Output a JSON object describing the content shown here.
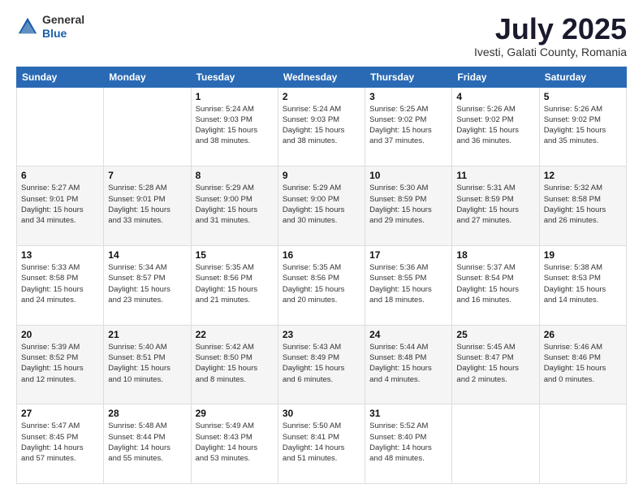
{
  "header": {
    "logo_general": "General",
    "logo_blue": "Blue",
    "month_title": "July 2025",
    "location": "Ivesti, Galati County, Romania"
  },
  "columns": [
    "Sunday",
    "Monday",
    "Tuesday",
    "Wednesday",
    "Thursday",
    "Friday",
    "Saturday"
  ],
  "weeks": [
    [
      {
        "day": "",
        "info": ""
      },
      {
        "day": "",
        "info": ""
      },
      {
        "day": "1",
        "info": "Sunrise: 5:24 AM\nSunset: 9:03 PM\nDaylight: 15 hours\nand 38 minutes."
      },
      {
        "day": "2",
        "info": "Sunrise: 5:24 AM\nSunset: 9:03 PM\nDaylight: 15 hours\nand 38 minutes."
      },
      {
        "day": "3",
        "info": "Sunrise: 5:25 AM\nSunset: 9:02 PM\nDaylight: 15 hours\nand 37 minutes."
      },
      {
        "day": "4",
        "info": "Sunrise: 5:26 AM\nSunset: 9:02 PM\nDaylight: 15 hours\nand 36 minutes."
      },
      {
        "day": "5",
        "info": "Sunrise: 5:26 AM\nSunset: 9:02 PM\nDaylight: 15 hours\nand 35 minutes."
      }
    ],
    [
      {
        "day": "6",
        "info": "Sunrise: 5:27 AM\nSunset: 9:01 PM\nDaylight: 15 hours\nand 34 minutes."
      },
      {
        "day": "7",
        "info": "Sunrise: 5:28 AM\nSunset: 9:01 PM\nDaylight: 15 hours\nand 33 minutes."
      },
      {
        "day": "8",
        "info": "Sunrise: 5:29 AM\nSunset: 9:00 PM\nDaylight: 15 hours\nand 31 minutes."
      },
      {
        "day": "9",
        "info": "Sunrise: 5:29 AM\nSunset: 9:00 PM\nDaylight: 15 hours\nand 30 minutes."
      },
      {
        "day": "10",
        "info": "Sunrise: 5:30 AM\nSunset: 8:59 PM\nDaylight: 15 hours\nand 29 minutes."
      },
      {
        "day": "11",
        "info": "Sunrise: 5:31 AM\nSunset: 8:59 PM\nDaylight: 15 hours\nand 27 minutes."
      },
      {
        "day": "12",
        "info": "Sunrise: 5:32 AM\nSunset: 8:58 PM\nDaylight: 15 hours\nand 26 minutes."
      }
    ],
    [
      {
        "day": "13",
        "info": "Sunrise: 5:33 AM\nSunset: 8:58 PM\nDaylight: 15 hours\nand 24 minutes."
      },
      {
        "day": "14",
        "info": "Sunrise: 5:34 AM\nSunset: 8:57 PM\nDaylight: 15 hours\nand 23 minutes."
      },
      {
        "day": "15",
        "info": "Sunrise: 5:35 AM\nSunset: 8:56 PM\nDaylight: 15 hours\nand 21 minutes."
      },
      {
        "day": "16",
        "info": "Sunrise: 5:35 AM\nSunset: 8:56 PM\nDaylight: 15 hours\nand 20 minutes."
      },
      {
        "day": "17",
        "info": "Sunrise: 5:36 AM\nSunset: 8:55 PM\nDaylight: 15 hours\nand 18 minutes."
      },
      {
        "day": "18",
        "info": "Sunrise: 5:37 AM\nSunset: 8:54 PM\nDaylight: 15 hours\nand 16 minutes."
      },
      {
        "day": "19",
        "info": "Sunrise: 5:38 AM\nSunset: 8:53 PM\nDaylight: 15 hours\nand 14 minutes."
      }
    ],
    [
      {
        "day": "20",
        "info": "Sunrise: 5:39 AM\nSunset: 8:52 PM\nDaylight: 15 hours\nand 12 minutes."
      },
      {
        "day": "21",
        "info": "Sunrise: 5:40 AM\nSunset: 8:51 PM\nDaylight: 15 hours\nand 10 minutes."
      },
      {
        "day": "22",
        "info": "Sunrise: 5:42 AM\nSunset: 8:50 PM\nDaylight: 15 hours\nand 8 minutes."
      },
      {
        "day": "23",
        "info": "Sunrise: 5:43 AM\nSunset: 8:49 PM\nDaylight: 15 hours\nand 6 minutes."
      },
      {
        "day": "24",
        "info": "Sunrise: 5:44 AM\nSunset: 8:48 PM\nDaylight: 15 hours\nand 4 minutes."
      },
      {
        "day": "25",
        "info": "Sunrise: 5:45 AM\nSunset: 8:47 PM\nDaylight: 15 hours\nand 2 minutes."
      },
      {
        "day": "26",
        "info": "Sunrise: 5:46 AM\nSunset: 8:46 PM\nDaylight: 15 hours\nand 0 minutes."
      }
    ],
    [
      {
        "day": "27",
        "info": "Sunrise: 5:47 AM\nSunset: 8:45 PM\nDaylight: 14 hours\nand 57 minutes."
      },
      {
        "day": "28",
        "info": "Sunrise: 5:48 AM\nSunset: 8:44 PM\nDaylight: 14 hours\nand 55 minutes."
      },
      {
        "day": "29",
        "info": "Sunrise: 5:49 AM\nSunset: 8:43 PM\nDaylight: 14 hours\nand 53 minutes."
      },
      {
        "day": "30",
        "info": "Sunrise: 5:50 AM\nSunset: 8:41 PM\nDaylight: 14 hours\nand 51 minutes."
      },
      {
        "day": "31",
        "info": "Sunrise: 5:52 AM\nSunset: 8:40 PM\nDaylight: 14 hours\nand 48 minutes."
      },
      {
        "day": "",
        "info": ""
      },
      {
        "day": "",
        "info": ""
      }
    ]
  ]
}
